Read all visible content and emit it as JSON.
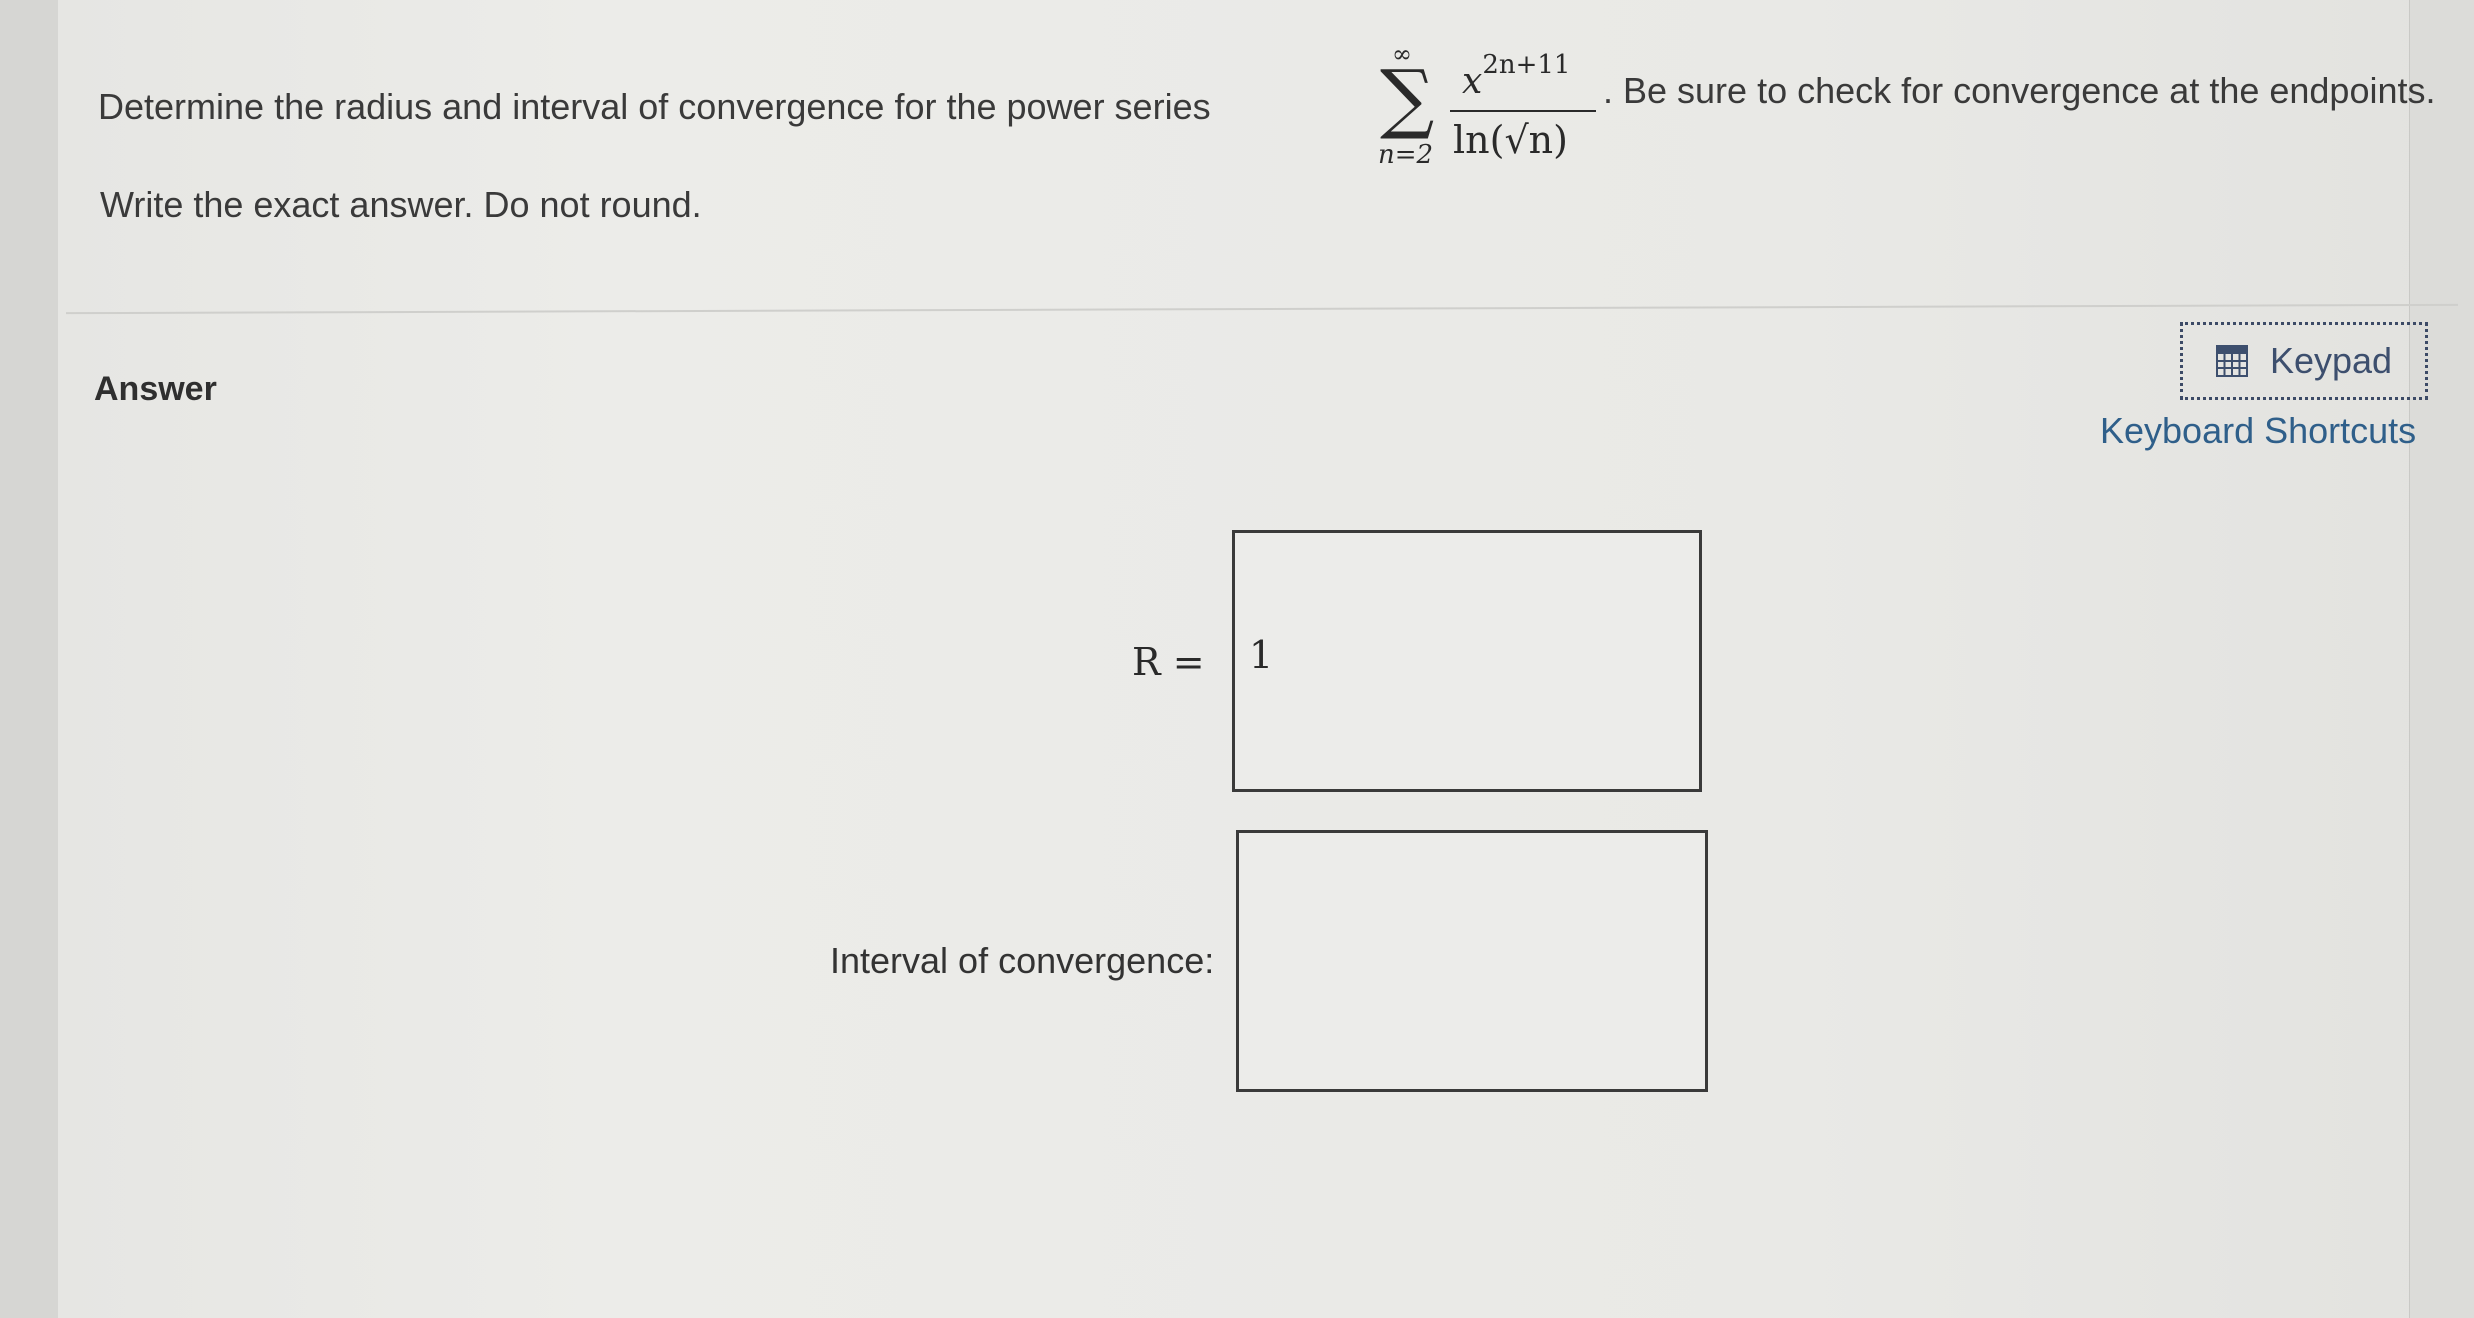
{
  "question": {
    "prefix": "Determine the radius and interval of convergence for the power series",
    "series": {
      "sum_upper": "∞",
      "sum_lower": "n=2",
      "numerator_base": "x",
      "numerator_exponent": "2n+11",
      "denominator": "ln(√n)"
    },
    "suffix": ". Be sure to check for convergence at the endpoints.",
    "instruction": "Write the exact answer. Do not round."
  },
  "answer": {
    "label": "Answer",
    "keypad_label": "Keypad",
    "keypad_icon": "calculator-icon",
    "shortcuts_label": "Keyboard Shortcuts",
    "radius_label": "R =",
    "radius_value": "1",
    "interval_label": "Interval of convergence:",
    "interval_value": ""
  },
  "colors": {
    "background": "#e9e9e6",
    "text": "#3a3a3a",
    "link": "#2f5f8a",
    "keypad_border": "#3c4a66"
  }
}
